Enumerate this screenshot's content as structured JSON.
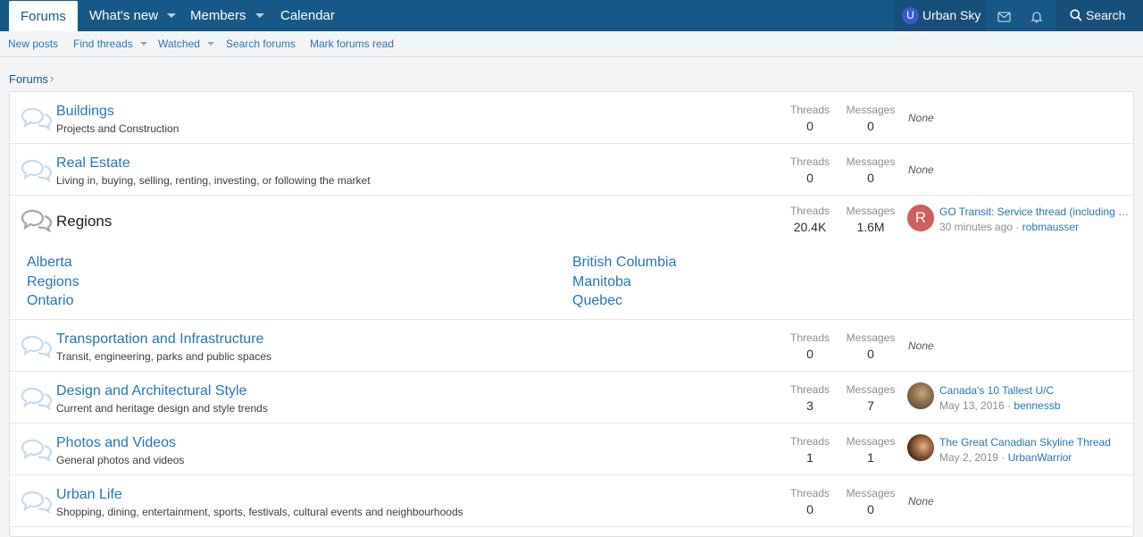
{
  "topnav": {
    "tabs": [
      {
        "label": "Forums",
        "active": true,
        "dropdown": false
      },
      {
        "label": "What's new",
        "active": false,
        "dropdown": true
      },
      {
        "label": "Members",
        "active": false,
        "dropdown": true
      },
      {
        "label": "Calendar",
        "active": false,
        "dropdown": false
      }
    ],
    "user": {
      "initial": "U",
      "name": "Urban Sky"
    },
    "search_label": "Search"
  },
  "subnav": {
    "links": [
      {
        "label": "New posts",
        "dropdown": false
      },
      {
        "label": "Find threads",
        "dropdown": true
      },
      {
        "label": "Watched",
        "dropdown": true
      },
      {
        "label": "Search forums",
        "dropdown": false
      },
      {
        "label": "Mark forums read",
        "dropdown": false
      }
    ]
  },
  "breadcrumb": {
    "label": "Forums",
    "separator": "›"
  },
  "stat_labels": {
    "threads": "Threads",
    "messages": "Messages"
  },
  "forums": [
    {
      "title": "Buildings",
      "desc": "Projects and Construction",
      "threads": "0",
      "messages": "0",
      "last": "None"
    },
    {
      "title": "Real Estate",
      "desc": "Living in, buying, selling, renting, investing, or following the market",
      "threads": "0",
      "messages": "0",
      "last": "None"
    },
    {
      "title": "Regions",
      "desc": "",
      "threads": "20.4K",
      "messages": "1.6M",
      "last_title": "GO Transit: Service thread (including …",
      "last_time": "30 minutes ago",
      "last_user": "robmausser",
      "last_initial": "R",
      "subforums": [
        "Alberta",
        "British Columbia",
        "Regions",
        "Manitoba",
        "Ontario",
        "Quebec"
      ]
    },
    {
      "title": "Transportation and Infrastructure",
      "desc": "Transit, engineering, parks and public spaces",
      "threads": "0",
      "messages": "0",
      "last": "None"
    },
    {
      "title": "Design and Architectural Style",
      "desc": "Current and heritage design and style trends",
      "threads": "3",
      "messages": "7",
      "last_title": "Canada's 10 Tallest U/C",
      "last_time": "May 13, 2016",
      "last_user": "bennessb"
    },
    {
      "title": "Photos and Videos",
      "desc": "General photos and videos",
      "threads": "1",
      "messages": "1",
      "last_title": "The Great Canadian Skyline Thread",
      "last_time": "May 2, 2019",
      "last_user": "UrbanWarrior"
    },
    {
      "title": "Urban Life",
      "desc": "Shopping, dining, entertainment, sports, festivals, cultural events and neighbourhoods",
      "threads": "0",
      "messages": "0",
      "last": "None"
    }
  ],
  "meta_separator": " · ",
  "colors": {
    "nav": "#185886",
    "link": "#2577b1",
    "page_bg": "#f3f4f6"
  }
}
